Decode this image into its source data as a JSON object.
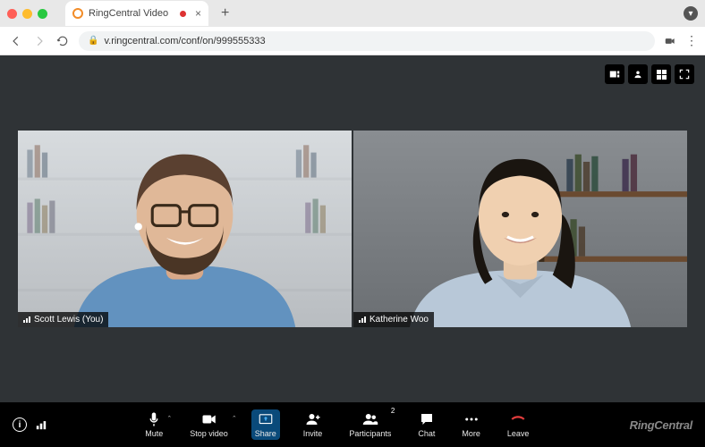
{
  "browser": {
    "tab_title": "RingCentral Video",
    "url": "v.ringcentral.com/conf/on/999555333"
  },
  "view_controls": {
    "filmstrip": "filmstrip-view",
    "speaker": "speaker-view",
    "gallery": "gallery-view",
    "fullscreen": "fullscreen"
  },
  "participants": [
    {
      "name": "Scott Lewis (You)"
    },
    {
      "name": "Katherine Woo"
    }
  ],
  "toolbar": {
    "mute": "Mute",
    "stop_video": "Stop video",
    "share": "Share",
    "invite": "Invite",
    "participants": "Participants",
    "participants_count": "2",
    "chat": "Chat",
    "more": "More",
    "leave": "Leave"
  },
  "brand": "RingCentral"
}
